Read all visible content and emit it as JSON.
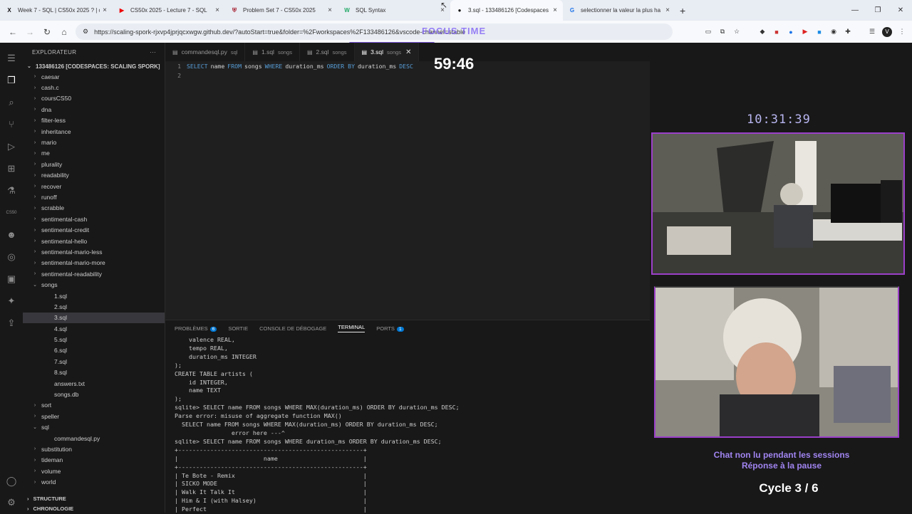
{
  "browser": {
    "tabs": [
      {
        "icon": "X",
        "title": "Week 7 - SQL | CS50x 2025 ? | c",
        "close": "×"
      },
      {
        "icon": "▶",
        "title": "CS50x 2025 - Lecture 7 - SQL",
        "close": "×"
      },
      {
        "icon": "⛨",
        "title": "Problem Set 7 - CS50x 2025",
        "close": "×"
      },
      {
        "icon": "W",
        "title": "SQL Syntax",
        "close": "×"
      },
      {
        "icon": "●",
        "title": "3.sql - 133486126 [Codespaces",
        "close": "×"
      },
      {
        "icon": "G",
        "title": "selectionner la valeur la plus ha",
        "close": "×"
      }
    ],
    "new_tab": "+",
    "url": "https://scaling-spork-rjxvp4jprjqcxwgw.github.dev/?autoStart=true&folder=%2Fworkspaces%2F133486126&vscode-channel=stable"
  },
  "overlay": {
    "focus_label": "FOCUS TIME",
    "timer": "59:46",
    "clock": "10:31:39",
    "chat_line1": "Chat non lu pendant les sessions",
    "chat_line2": "Réponse à la pause",
    "cycle": "Cycle 3 / 6"
  },
  "explorer": {
    "title": "EXPLORATEUR",
    "workspace": "133486126 [CODESPACES: SCALING SPORK]",
    "items": [
      {
        "label": "caesar",
        "type": "folder",
        "depth": 0,
        "open": false
      },
      {
        "label": "cash.c",
        "type": "folder",
        "depth": 0,
        "open": false
      },
      {
        "label": "coursCS50",
        "type": "folder",
        "depth": 0,
        "open": false
      },
      {
        "label": "dna",
        "type": "folder",
        "depth": 0,
        "open": false
      },
      {
        "label": "filter-less",
        "type": "folder",
        "depth": 0,
        "open": false
      },
      {
        "label": "inheritance",
        "type": "folder",
        "depth": 0,
        "open": false
      },
      {
        "label": "mario",
        "type": "folder",
        "depth": 0,
        "open": false
      },
      {
        "label": "me",
        "type": "folder",
        "depth": 0,
        "open": false
      },
      {
        "label": "plurality",
        "type": "folder",
        "depth": 0,
        "open": false
      },
      {
        "label": "readability",
        "type": "folder",
        "depth": 0,
        "open": false
      },
      {
        "label": "recover",
        "type": "folder",
        "depth": 0,
        "open": false
      },
      {
        "label": "runoff",
        "type": "folder",
        "depth": 0,
        "open": false
      },
      {
        "label": "scrabble",
        "type": "folder",
        "depth": 0,
        "open": false
      },
      {
        "label": "sentimental-cash",
        "type": "folder",
        "depth": 0,
        "open": false
      },
      {
        "label": "sentimental-credit",
        "type": "folder",
        "depth": 0,
        "open": false
      },
      {
        "label": "sentimental-hello",
        "type": "folder",
        "depth": 0,
        "open": false
      },
      {
        "label": "sentimental-mario-less",
        "type": "folder",
        "depth": 0,
        "open": false
      },
      {
        "label": "sentimental-mario-more",
        "type": "folder",
        "depth": 0,
        "open": false
      },
      {
        "label": "sentimental-readability",
        "type": "folder",
        "depth": 0,
        "open": false
      },
      {
        "label": "songs",
        "type": "folder",
        "depth": 0,
        "open": true
      },
      {
        "label": "1.sql",
        "type": "file",
        "depth": 1
      },
      {
        "label": "2.sql",
        "type": "file",
        "depth": 1
      },
      {
        "label": "3.sql",
        "type": "file",
        "depth": 1,
        "selected": true
      },
      {
        "label": "4.sql",
        "type": "file",
        "depth": 1
      },
      {
        "label": "5.sql",
        "type": "file",
        "depth": 1
      },
      {
        "label": "6.sql",
        "type": "file",
        "depth": 1
      },
      {
        "label": "7.sql",
        "type": "file",
        "depth": 1
      },
      {
        "label": "8.sql",
        "type": "file",
        "depth": 1
      },
      {
        "label": "answers.txt",
        "type": "file",
        "depth": 1
      },
      {
        "label": "songs.db",
        "type": "file",
        "depth": 1
      },
      {
        "label": "sort",
        "type": "folder",
        "depth": 0,
        "open": false
      },
      {
        "label": "speller",
        "type": "folder",
        "depth": 0,
        "open": false
      },
      {
        "label": "sql",
        "type": "folder",
        "depth": 0,
        "open": true
      },
      {
        "label": "commandesql.py",
        "type": "file",
        "depth": 1
      },
      {
        "label": "substitution",
        "type": "folder",
        "depth": 0,
        "open": false
      },
      {
        "label": "tideman",
        "type": "folder",
        "depth": 0,
        "open": false
      },
      {
        "label": "volume",
        "type": "folder",
        "depth": 0,
        "open": false
      },
      {
        "label": "world",
        "type": "folder",
        "depth": 0,
        "open": false
      }
    ],
    "structure": "STRUCTURE",
    "timeline": "CHRONOLOGIE"
  },
  "editor": {
    "tabs": [
      {
        "label": "commandesql.py",
        "desc": "sql"
      },
      {
        "label": "1.sql",
        "desc": "songs"
      },
      {
        "label": "2.sql",
        "desc": "songs"
      },
      {
        "label": "3.sql",
        "desc": "songs",
        "active": true
      }
    ],
    "lines": [
      {
        "n": "1",
        "tokens": [
          [
            "kw",
            "SELECT"
          ],
          [
            "",
            "name"
          ],
          [
            "kw",
            "FROM"
          ],
          [
            "",
            "songs"
          ],
          [
            "kw",
            "WHERE"
          ],
          [
            "",
            "duration_ms"
          ],
          [
            "kw",
            "ORDER BY"
          ],
          [
            "",
            "duration_ms"
          ],
          [
            "kw",
            "DESC"
          ]
        ]
      },
      {
        "n": "2",
        "tokens": []
      }
    ]
  },
  "panel": {
    "tabs": [
      {
        "label": "PROBLÈMES",
        "badge": "6"
      },
      {
        "label": "SORTIE"
      },
      {
        "label": "CONSOLE DE DÉBOGAGE"
      },
      {
        "label": "TERMINAL",
        "active": true
      },
      {
        "label": "PORTS",
        "badge": "1"
      }
    ],
    "terminal": [
      "    valence REAL,",
      "    tempo REAL,",
      "    duration_ms INTEGER",
      ");",
      "CREATE TABLE artists (",
      "    id INTEGER,",
      "    name TEXT",
      ");",
      "sqlite> SELECT name FROM songs WHERE MAX(duration_ms) ORDER BY duration_ms DESC;",
      "Parse error: misuse of aggregate function MAX()",
      "  SELECT name FROM songs WHERE MAX(duration_ms) ORDER BY duration_ms DESC;",
      "                error here ---^",
      "sqlite> SELECT name FROM songs WHERE duration_ms ORDER BY duration_ms DESC;",
      "+----------------------------------------------------+",
      "|                        name                        |",
      "+----------------------------------------------------+",
      "| Te Bote - Remix                                    |",
      "| SICKO MODE                                         |",
      "| Walk It Talk It                                    |",
      "| Him & I (with Halsey)                              |",
      "| Perfect                                            |"
    ]
  }
}
